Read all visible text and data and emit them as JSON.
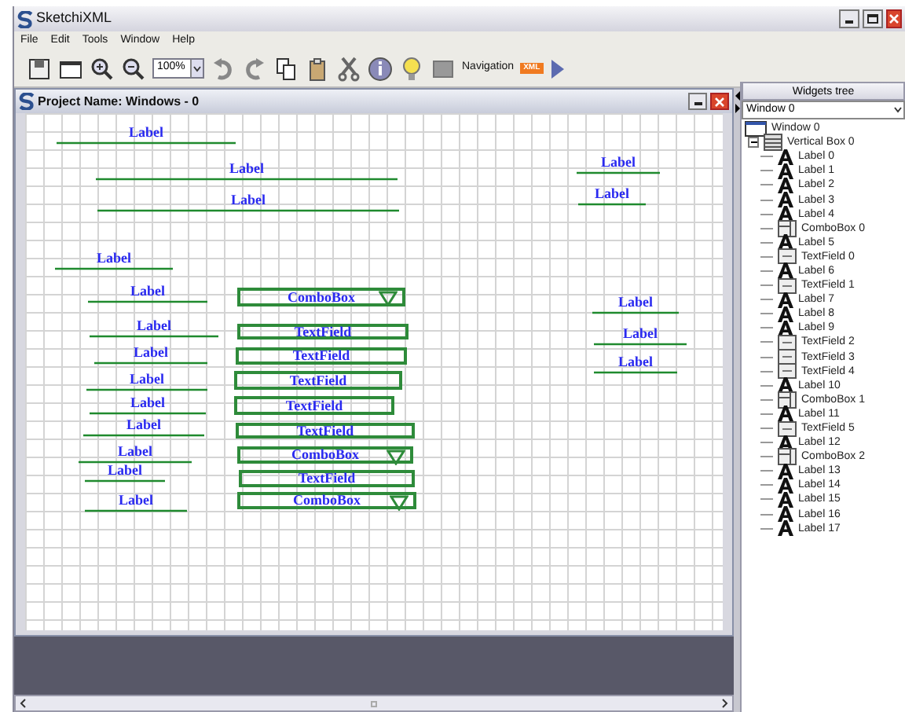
{
  "window": {
    "title": "SketchiXML"
  },
  "menu": [
    "File",
    "Edit",
    "Tools",
    "Window",
    "Help"
  ],
  "toolbar": {
    "zoom": "100%",
    "navigation": "Navigation",
    "badge": "XML"
  },
  "project": {
    "title": "Project Name: Windows - 0",
    "widgets": [
      {
        "kind": "label",
        "text": "Label"
      },
      {
        "kind": "label",
        "text": "Label"
      },
      {
        "kind": "label",
        "text": "Label"
      },
      {
        "kind": "label",
        "text": "Label"
      },
      {
        "kind": "label",
        "text": "Label"
      },
      {
        "kind": "label",
        "text": "Label"
      },
      {
        "kind": "label",
        "text": "Label"
      },
      {
        "kind": "combobox",
        "text": "ComboBox"
      },
      {
        "kind": "label",
        "text": "Label"
      },
      {
        "kind": "label",
        "text": "Label"
      },
      {
        "kind": "textfield",
        "text": "TextField"
      },
      {
        "kind": "label",
        "text": "Label"
      },
      {
        "kind": "label",
        "text": "Label"
      },
      {
        "kind": "textfield",
        "text": "TextField"
      },
      {
        "kind": "label",
        "text": "Label"
      },
      {
        "kind": "label",
        "text": "Label"
      },
      {
        "kind": "textfield",
        "text": "TextField"
      },
      {
        "kind": "label",
        "text": "Label"
      },
      {
        "kind": "textfield",
        "text": "TextField"
      },
      {
        "kind": "label",
        "text": "Label"
      },
      {
        "kind": "textfield",
        "text": "TextField"
      },
      {
        "kind": "label",
        "text": "Label"
      },
      {
        "kind": "combobox",
        "text": "ComboBox"
      },
      {
        "kind": "label",
        "text": "Label"
      },
      {
        "kind": "textfield",
        "text": "TextField"
      },
      {
        "kind": "label",
        "text": "Label"
      },
      {
        "kind": "combobox",
        "text": "ComboBox"
      }
    ]
  },
  "widgets_tree": {
    "header": "Widgets tree",
    "selector": "Window 0",
    "tree": [
      {
        "kind": "window",
        "label": "Window 0",
        "children": [
          {
            "kind": "vbox",
            "label": "Vertical Box 0",
            "expanded": true,
            "children": [
              {
                "kind": "label",
                "label": "Label 0"
              },
              {
                "kind": "label",
                "label": "Label 1"
              },
              {
                "kind": "label",
                "label": "Label 2"
              },
              {
                "kind": "label",
                "label": "Label 3"
              },
              {
                "kind": "label",
                "label": "Label 4"
              },
              {
                "kind": "combobox",
                "label": "ComboBox 0"
              },
              {
                "kind": "label",
                "label": "Label 5"
              },
              {
                "kind": "textfield",
                "label": "TextField 0"
              },
              {
                "kind": "label",
                "label": "Label 6"
              },
              {
                "kind": "textfield",
                "label": "TextField 1"
              },
              {
                "kind": "label",
                "label": "Label 7"
              },
              {
                "kind": "label",
                "label": "Label 8"
              },
              {
                "kind": "label",
                "label": "Label 9"
              },
              {
                "kind": "textfield",
                "label": "TextField 2"
              },
              {
                "kind": "textfield",
                "label": "TextField 3"
              },
              {
                "kind": "textfield",
                "label": "TextField 4"
              },
              {
                "kind": "label",
                "label": "Label 10"
              },
              {
                "kind": "combobox",
                "label": "ComboBox 1"
              },
              {
                "kind": "label",
                "label": "Label 11"
              },
              {
                "kind": "textfield",
                "label": "TextField 5"
              },
              {
                "kind": "label",
                "label": "Label 12"
              },
              {
                "kind": "combobox",
                "label": "ComboBox 2"
              },
              {
                "kind": "label",
                "label": "Label 13"
              },
              {
                "kind": "label",
                "label": "Label 14"
              },
              {
                "kind": "label",
                "label": "Label 15"
              },
              {
                "kind": "label",
                "label": "Label 16"
              },
              {
                "kind": "label",
                "label": "Label 17"
              }
            ]
          }
        ]
      }
    ]
  }
}
